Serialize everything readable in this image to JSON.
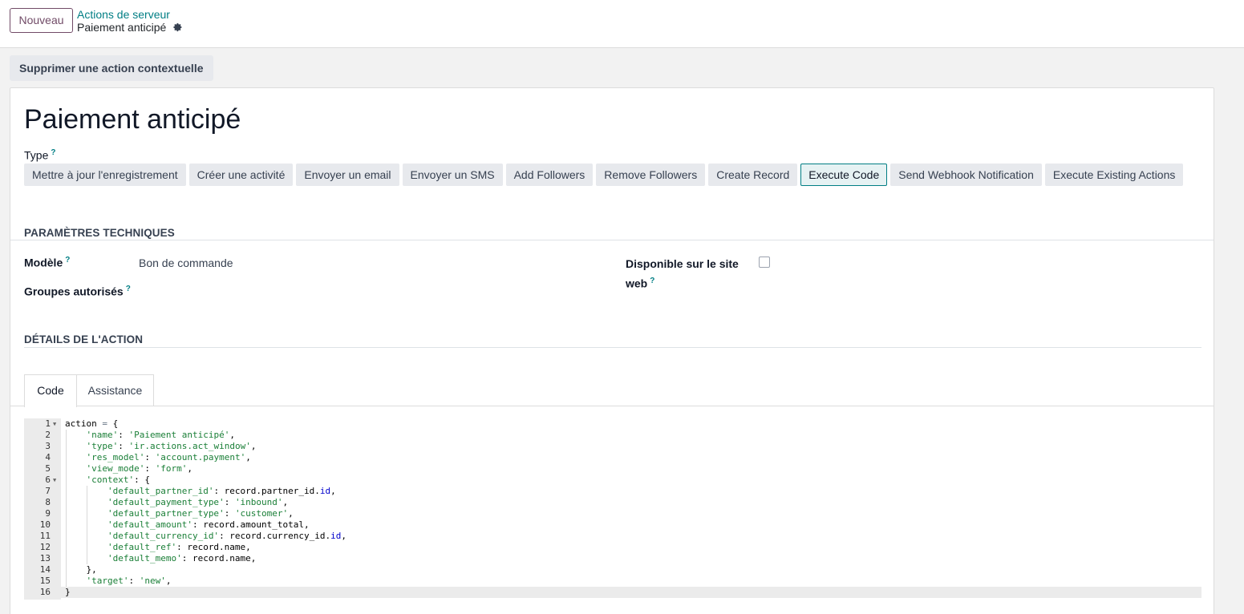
{
  "header": {
    "new_button": "Nouveau",
    "breadcrumb_parent": "Actions de serveur",
    "record_name": "Paiement anticipé",
    "gear_icon": "gear-icon"
  },
  "action_bar": {
    "delete_contextual": "Supprimer une action contextuelle"
  },
  "form": {
    "title": "Paiement anticipé",
    "type_label": "Type",
    "help_mark": "?",
    "types": [
      {
        "label": "Mettre à jour l'enregistrement",
        "active": false
      },
      {
        "label": "Créer une activité",
        "active": false
      },
      {
        "label": "Envoyer un email",
        "active": false
      },
      {
        "label": "Envoyer un SMS",
        "active": false
      },
      {
        "label": "Add Followers",
        "active": false
      },
      {
        "label": "Remove Followers",
        "active": false
      },
      {
        "label": "Create Record",
        "active": false
      },
      {
        "label": "Execute Code",
        "active": true
      },
      {
        "label": "Send Webhook Notification",
        "active": false
      },
      {
        "label": "Execute Existing Actions",
        "active": false
      }
    ],
    "tech_section": "PARAMÈTRES TECHNIQUES",
    "model_label": "Modèle",
    "model_value": "Bon de commande",
    "groups_label": "Groupes autorisés",
    "website_label_line1": "Disponible sur le site",
    "website_label_line2": "web",
    "website_checked": false,
    "details_section": "DÉTAILS DE L'ACTION",
    "tabs": [
      {
        "label": "Code",
        "active": true
      },
      {
        "label": "Assistance",
        "active": false
      }
    ]
  },
  "code": {
    "current_line": 16,
    "lines": [
      {
        "n": "1",
        "fold": true,
        "text": "action = {"
      },
      {
        "n": "2",
        "fold": false,
        "text": "    'name': 'Paiement anticipé',"
      },
      {
        "n": "3",
        "fold": false,
        "text": "    'type': 'ir.actions.act_window',"
      },
      {
        "n": "4",
        "fold": false,
        "text": "    'res_model': 'account.payment',"
      },
      {
        "n": "5",
        "fold": false,
        "text": "    'view_mode': 'form',"
      },
      {
        "n": "6",
        "fold": true,
        "text": "    'context': {"
      },
      {
        "n": "7",
        "fold": false,
        "text": "        'default_partner_id': record.partner_id.id,"
      },
      {
        "n": "8",
        "fold": false,
        "text": "        'default_payment_type': 'inbound',"
      },
      {
        "n": "9",
        "fold": false,
        "text": "        'default_partner_type': 'customer',"
      },
      {
        "n": "10",
        "fold": false,
        "text": "        'default_amount': record.amount_total,"
      },
      {
        "n": "11",
        "fold": false,
        "text": "        'default_currency_id': record.currency_id.id,"
      },
      {
        "n": "12",
        "fold": false,
        "text": "        'default_ref': record.name,"
      },
      {
        "n": "13",
        "fold": false,
        "text": "        'default_memo': record.name,"
      },
      {
        "n": "14",
        "fold": false,
        "text": "    },"
      },
      {
        "n": "15",
        "fold": false,
        "text": "    'target': 'new',"
      },
      {
        "n": "16",
        "fold": false,
        "text": "}"
      }
    ]
  },
  "colors": {
    "accent": "#017e84",
    "brand": "#714b67"
  }
}
